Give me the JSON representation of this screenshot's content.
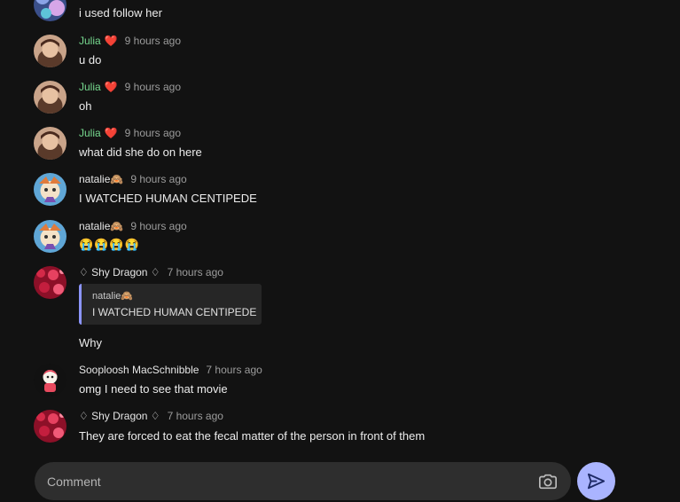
{
  "messages": [
    {
      "username": "",
      "time": "",
      "text": "i used follow her",
      "avatar": "avatar-blue-pattern"
    },
    {
      "username": "Julia",
      "username_suffix": "❤️",
      "time": "9 hours ago",
      "text": "u do",
      "avatar": "avatar-portrait"
    },
    {
      "username": "Julia",
      "username_suffix": "❤️",
      "time": "9 hours ago",
      "text": "oh",
      "avatar": "avatar-portrait"
    },
    {
      "username": "Julia",
      "username_suffix": "❤️",
      "time": "9 hours ago",
      "text": "what did she do on here",
      "avatar": "avatar-portrait"
    },
    {
      "username": "natalie🙈",
      "time": "9 hours ago",
      "text": "I WATCHED HUMAN CENTIPEDE",
      "avatar": "avatar-cartoon"
    },
    {
      "username": "natalie🙈",
      "time": "9 hours ago",
      "text": "😭😭😭😭",
      "avatar": "avatar-cartoon"
    },
    {
      "username": "♢ Shy Dragon ♢",
      "time": "7 hours ago",
      "quote": {
        "username": "natalie🙈",
        "text": "I WATCHED HUMAN CENTIPEDE"
      },
      "text": "Why",
      "avatar": "avatar-red-pattern"
    },
    {
      "username": "Sooploosh MacSchnibble",
      "time": "7 hours ago",
      "text": "omg I need to see that movie",
      "avatar": "avatar-character"
    },
    {
      "username": "♢ Shy Dragon ♢",
      "time": "7 hours ago",
      "text": "They are forced to eat the fecal matter of the person in front of them",
      "avatar": "avatar-red-pattern"
    }
  ],
  "composer": {
    "placeholder": "Comment",
    "camera_icon": "camera-icon",
    "send_icon": "send-icon"
  },
  "colors": {
    "background": "#121212",
    "username_green": "#77d98f",
    "send_button": "#aab4ff",
    "quote_bar": "#8c95ff"
  }
}
